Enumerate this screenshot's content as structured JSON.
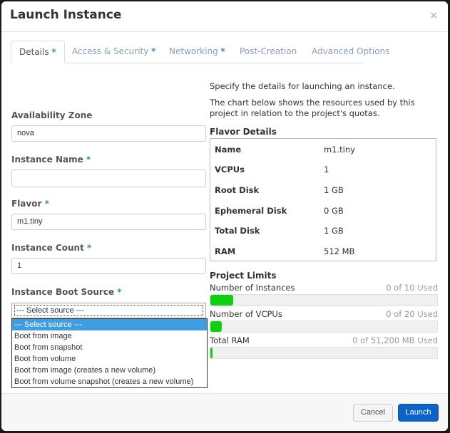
{
  "dialog": {
    "title": "Launch Instance",
    "close_label": "×"
  },
  "tabs": [
    {
      "label": "Details",
      "required": true,
      "active": true
    },
    {
      "label": "Access & Security",
      "required": true,
      "active": false
    },
    {
      "label": "Networking",
      "required": true,
      "active": false
    },
    {
      "label": "Post-Creation",
      "required": false,
      "active": false
    },
    {
      "label": "Advanced Options",
      "required": false,
      "active": false
    }
  ],
  "required_marker": "*",
  "form": {
    "availability_zone": {
      "label": "Availability Zone",
      "value": "nova"
    },
    "instance_name": {
      "label": "Instance Name",
      "value": ""
    },
    "flavor": {
      "label": "Flavor",
      "value": "m1.tiny"
    },
    "instance_count": {
      "label": "Instance Count",
      "value": "1"
    },
    "boot_source": {
      "label": "Instance Boot Source",
      "value": "--- Select source ---",
      "options": [
        "--- Select source ---",
        "Boot from image",
        "Boot from snapshot",
        "Boot from volume",
        "Boot from image (creates a new volume)",
        "Boot from volume snapshot (creates a new volume)"
      ],
      "highlighted_index": 0
    }
  },
  "info": {
    "intro1": "Specify the details for launching an instance.",
    "intro2": "The chart below shows the resources used by this project in relation to the project's quotas."
  },
  "flavor_details": {
    "title": "Flavor Details",
    "rows": [
      {
        "key": "Name",
        "value": "m1.tiny"
      },
      {
        "key": "VCPUs",
        "value": "1"
      },
      {
        "key": "Root Disk",
        "value": "1 GB"
      },
      {
        "key": "Ephemeral Disk",
        "value": "0 GB"
      },
      {
        "key": "Total Disk",
        "value": "1 GB"
      },
      {
        "key": "RAM",
        "value": "512 MB"
      }
    ]
  },
  "project_limits": {
    "title": "Project Limits",
    "items": [
      {
        "label": "Number of Instances",
        "used_text": "0 of 10 Used",
        "fill_percent": 10
      },
      {
        "label": "Number of VCPUs",
        "used_text": "0 of 20 Used",
        "fill_percent": 5
      },
      {
        "label": "Total RAM",
        "used_text": "0 of 51,200 MB Used",
        "fill_percent": 1
      }
    ],
    "fill_color": "#0cd10c"
  },
  "footer": {
    "cancel_label": "Cancel",
    "launch_label": "Launch"
  }
}
